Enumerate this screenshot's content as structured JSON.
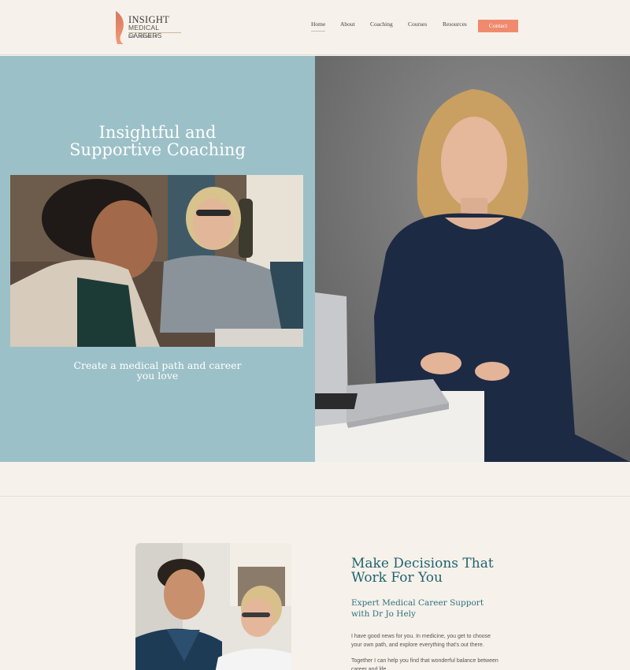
{
  "logo": {
    "line1": "INSIGHT",
    "line2": "MEDICAL CAREERS",
    "line3": "DR JO HELY"
  },
  "nav": {
    "items": [
      "Home",
      "About",
      "Coaching",
      "Courses",
      "Resources"
    ],
    "contact_label": "Contact"
  },
  "hero": {
    "title_line1": "Insightful and",
    "title_line2": "Supportive Coaching",
    "subtitle_line1": "Create a medical path and career",
    "subtitle_line2": "you love"
  },
  "section": {
    "title_line1": "Make Decisions That",
    "title_line2": "Work For You",
    "subtitle_line1": "Expert Medical Career Support",
    "subtitle_line2": "with Dr Jo Hely",
    "paragraph1": "I have good news for you. In medicine, you get to choose your own path, and explore everything that's out there.",
    "paragraph2": "Together I can help you find that wonderful balance between career and life."
  },
  "colors": {
    "accent": "#f08a6e",
    "hero_panel": "#9cc0c8",
    "heading_teal": "#1f6470",
    "background": "#f6f1ea"
  }
}
